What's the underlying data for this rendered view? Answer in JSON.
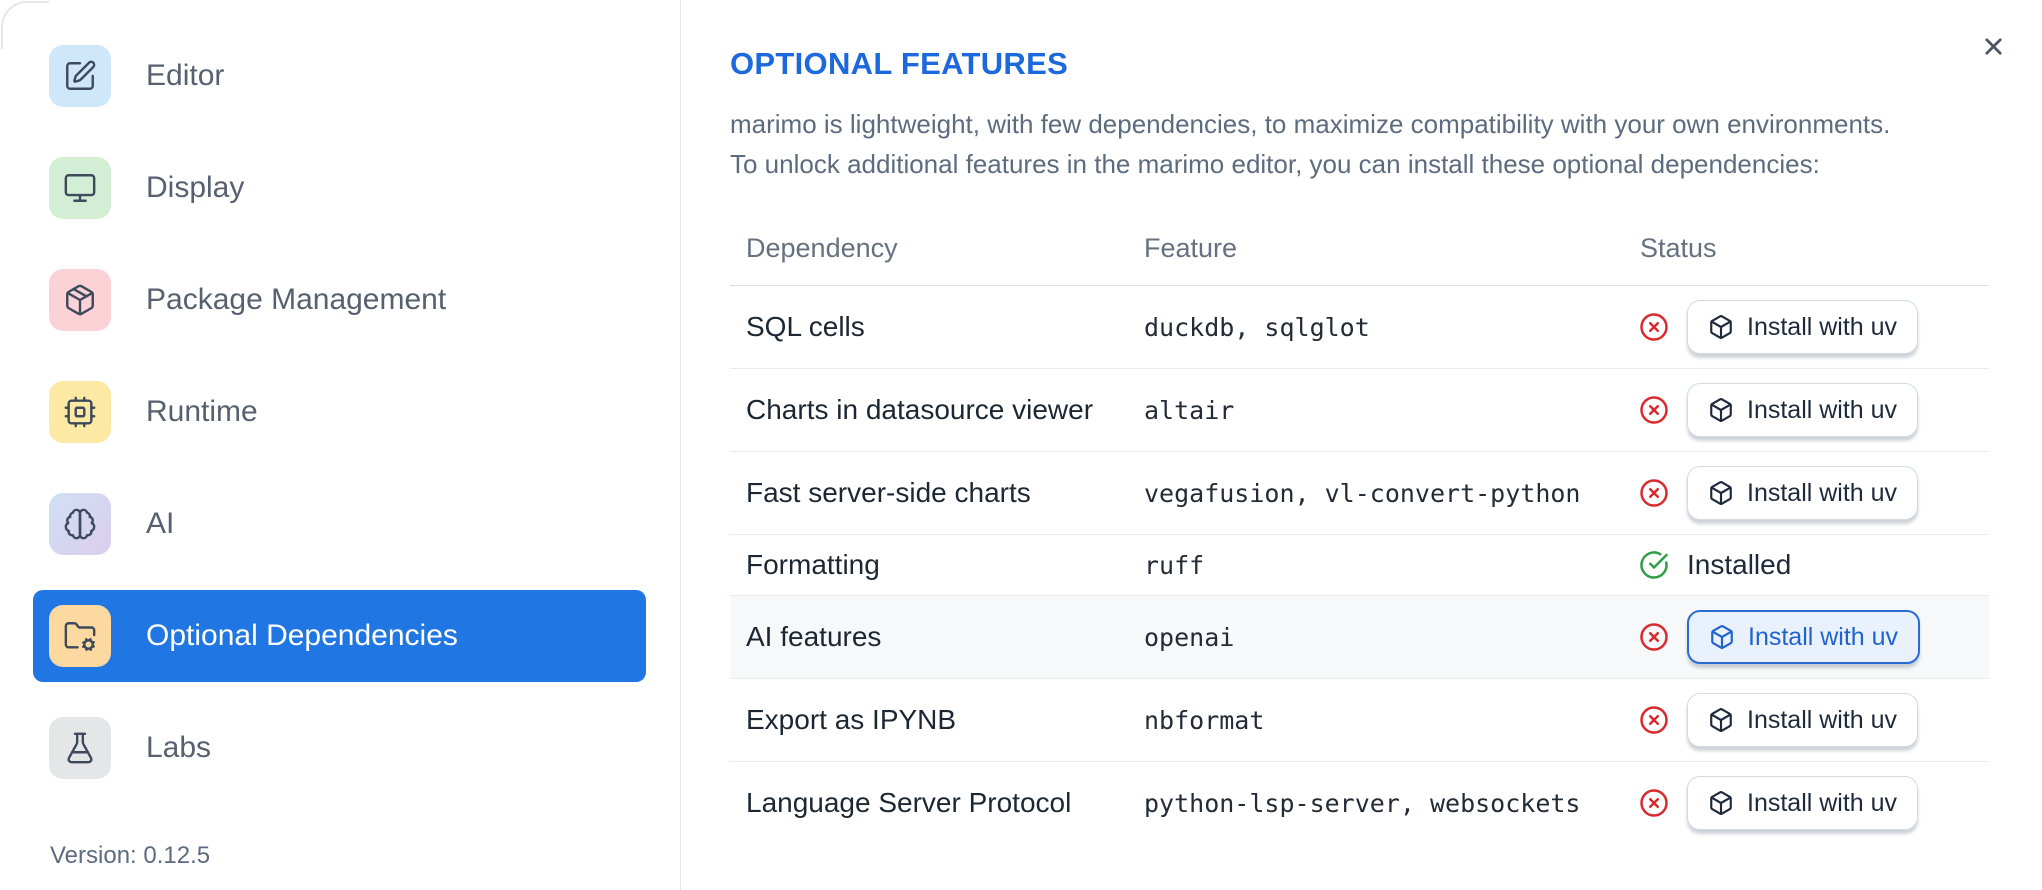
{
  "sidebar": {
    "items": [
      {
        "label": "Editor",
        "icon": "editor-pen-icon",
        "icon_bg": "#cfe7fb",
        "selected": false
      },
      {
        "label": "Display",
        "icon": "display-monitor-icon",
        "icon_bg": "#d2eed4",
        "selected": false
      },
      {
        "label": "Package Management",
        "icon": "package-icon",
        "icon_bg": "#fbd3d6",
        "selected": false
      },
      {
        "label": "Runtime",
        "icon": "cpu-icon",
        "icon_bg": "#fce9a4",
        "selected": false
      },
      {
        "label": "AI",
        "icon": "brain-icon",
        "icon_bg": "#cfe0f3",
        "icon_bg2": "#dbcdee",
        "selected": false
      },
      {
        "label": "Optional Dependencies",
        "icon": "folder-cog-icon",
        "icon_bg": "#fcd9a1",
        "selected": true
      },
      {
        "label": "Labs",
        "icon": "flask-icon",
        "icon_bg": "#e5e6e8",
        "selected": false
      }
    ],
    "version_label": "Version: 0.12.5"
  },
  "panel": {
    "title": "OPTIONAL FEATURES",
    "description_lines": [
      "marimo is lightweight, with few dependencies, to maximize compatibility with your own environments.",
      "To unlock additional features in the marimo editor, you can install these optional dependencies:"
    ],
    "table": {
      "headers": [
        "Dependency",
        "Feature",
        "Status"
      ],
      "rows": [
        {
          "dependency": "SQL cells",
          "feature": "duckdb, sqlglot",
          "status": "not-installed",
          "action": "Install with uv",
          "highlighted": false
        },
        {
          "dependency": "Charts in datasource viewer",
          "feature": "altair",
          "status": "not-installed",
          "action": "Install with uv",
          "highlighted": false
        },
        {
          "dependency": "Fast server-side charts",
          "feature": "vegafusion, vl-convert-python",
          "status": "not-installed",
          "action": "Install with uv",
          "highlighted": false
        },
        {
          "dependency": "Formatting",
          "feature": "ruff",
          "status": "installed",
          "status_label": "Installed",
          "highlighted": false
        },
        {
          "dependency": "AI features",
          "feature": "openai",
          "status": "not-installed",
          "action": "Install with uv",
          "highlighted": true
        },
        {
          "dependency": "Export as IPYNB",
          "feature": "nbformat",
          "status": "not-installed",
          "action": "Install with uv",
          "highlighted": false
        },
        {
          "dependency": "Language Server Protocol",
          "feature": "python-lsp-server, websockets",
          "status": "not-installed",
          "action": "Install with uv",
          "highlighted": false
        }
      ]
    }
  },
  "colors": {
    "selected_item_blue": "#2077e3",
    "title_blue": "#1b69dd",
    "error_red": "#d92b2f",
    "success_green": "#2f9e48",
    "highlight_button_bg": "#e9f1fd",
    "highlight_button_border": "#2b6bd3"
  }
}
